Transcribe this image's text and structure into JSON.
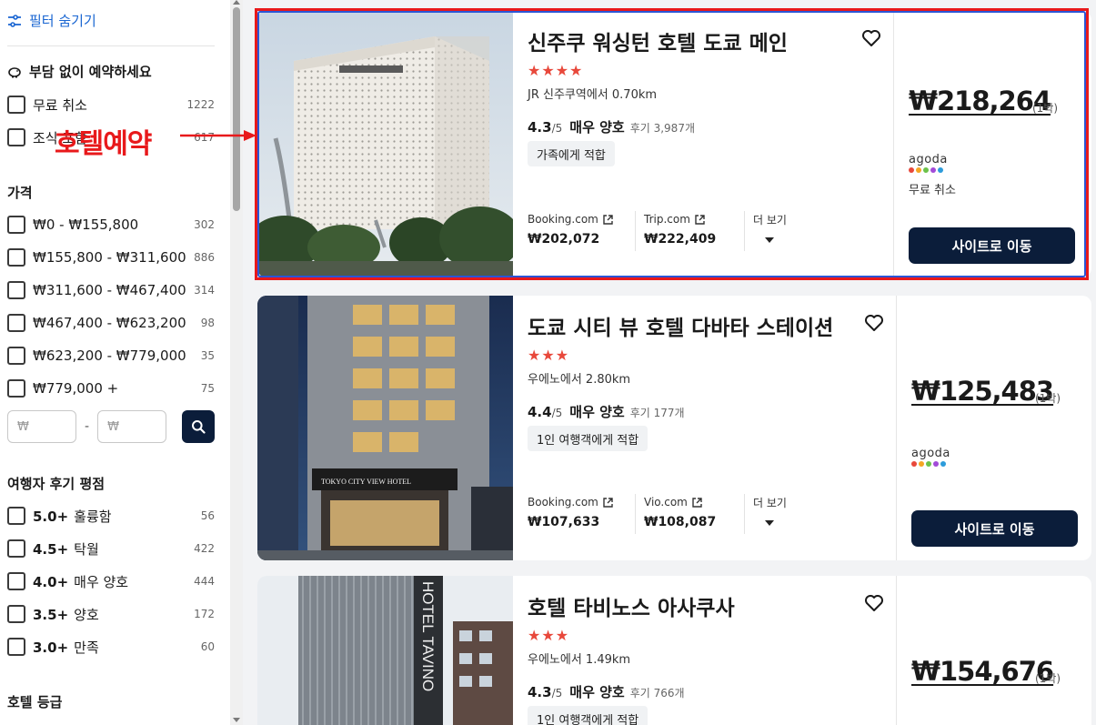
{
  "sidebar": {
    "filter_toggle": "필터 숨기기",
    "booking_section": {
      "title": "부담 없이 예약하세요",
      "items": [
        {
          "label": "무료 취소",
          "count": "1222"
        },
        {
          "label": "조식 포함",
          "count": "617"
        }
      ]
    },
    "price_section": {
      "title": "가격",
      "items": [
        {
          "label": "₩0 - ₩155,800",
          "count": "302"
        },
        {
          "label": "₩155,800 - ₩311,600",
          "count": "886"
        },
        {
          "label": "₩311,600 - ₩467,400",
          "count": "314"
        },
        {
          "label": "₩467,400 - ₩623,200",
          "count": "98"
        },
        {
          "label": "₩623,200 - ₩779,000",
          "count": "35"
        },
        {
          "label": "₩779,000 +",
          "count": "75"
        }
      ],
      "min_placeholder": "₩",
      "max_placeholder": "₩",
      "dash": "-"
    },
    "review_section": {
      "title": "여행자 후기 평점",
      "items": [
        {
          "score": "5.0+",
          "label": "훌륭함",
          "count": "56"
        },
        {
          "score": "4.5+",
          "label": "탁월",
          "count": "422"
        },
        {
          "score": "4.0+",
          "label": "매우 양호",
          "count": "444"
        },
        {
          "score": "3.5+",
          "label": "양호",
          "count": "172"
        },
        {
          "score": "3.0+",
          "label": "만족",
          "count": "60"
        }
      ]
    },
    "hotel_class_section": {
      "title": "호텔 등급"
    }
  },
  "annotation": {
    "text": "호텔예약",
    "color": "#e8191b"
  },
  "hotels": [
    {
      "name": "신주쿠 워싱턴 호텔 도쿄 메인",
      "stars": "★★★★",
      "distance": "JR 신주쿠역에서 0.70km",
      "score": "4.3",
      "outof": "/5",
      "rating_word": "매우 양호",
      "reviews": "후기 3,987개",
      "tag": "가족에게 적합",
      "providers": [
        {
          "name": "Booking.com",
          "price": "₩202,072"
        },
        {
          "name": "Trip.com",
          "price": "₩222,409"
        }
      ],
      "more": "더 보기",
      "price": "₩218,264",
      "per_night": "(1박)",
      "partner": "agoda",
      "free_cancel": "무료 취소",
      "button": "사이트로 이동"
    },
    {
      "name": "도쿄 시티 뷰 호텔 다바타 스테이션",
      "stars": "★★★",
      "distance": "우에노에서 2.80km",
      "score": "4.4",
      "outof": "/5",
      "rating_word": "매우 양호",
      "reviews": "후기 177개",
      "tag": "1인 여행객에게 적합",
      "providers": [
        {
          "name": "Booking.com",
          "price": "₩107,633"
        },
        {
          "name": "Vio.com",
          "price": "₩108,087"
        }
      ],
      "more": "더 보기",
      "price": "₩125,483",
      "per_night": "(1박)",
      "partner": "agoda",
      "button": "사이트로 이동",
      "image_sign": "TOKYO CITY VIEW HOTEL"
    },
    {
      "name": "호텔 타비노스 아사쿠사",
      "stars": "★★★",
      "distance": "우에노에서 1.49km",
      "score": "4.3",
      "outof": "/5",
      "rating_word": "매우 양호",
      "reviews": "후기 766개",
      "tag": "1인 여행객에게 적합",
      "price": "₩154,676",
      "per_night": "(1박)",
      "image_sign": "HOTEL TAVINO"
    }
  ],
  "colors": {
    "accent_blue": "#1a66d2",
    "button_navy": "#0b1d3a",
    "star_red": "#e8483b",
    "highlight_red": "#e8191b",
    "highlight_blue": "#2b55d6"
  }
}
